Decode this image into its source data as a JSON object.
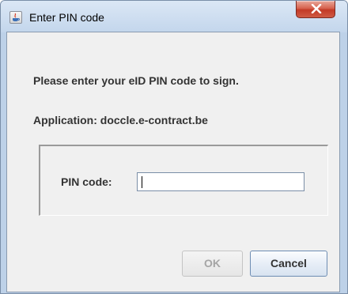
{
  "window": {
    "title": "Enter PIN code",
    "title_icon": "java-applet-icon",
    "close_icon": "close-icon"
  },
  "dialog": {
    "prompt": "Please enter your eID PIN code to sign.",
    "application": "Application: doccle.e-contract.be",
    "pin_label": "PIN code:",
    "pin_value": ""
  },
  "buttons": {
    "ok_label": "OK",
    "ok_enabled": false,
    "cancel_label": "Cancel"
  },
  "colors": {
    "close_button": "#c23a26",
    "titlebar": "#c3d6ec",
    "dialog_background": "#f0f0f0"
  }
}
